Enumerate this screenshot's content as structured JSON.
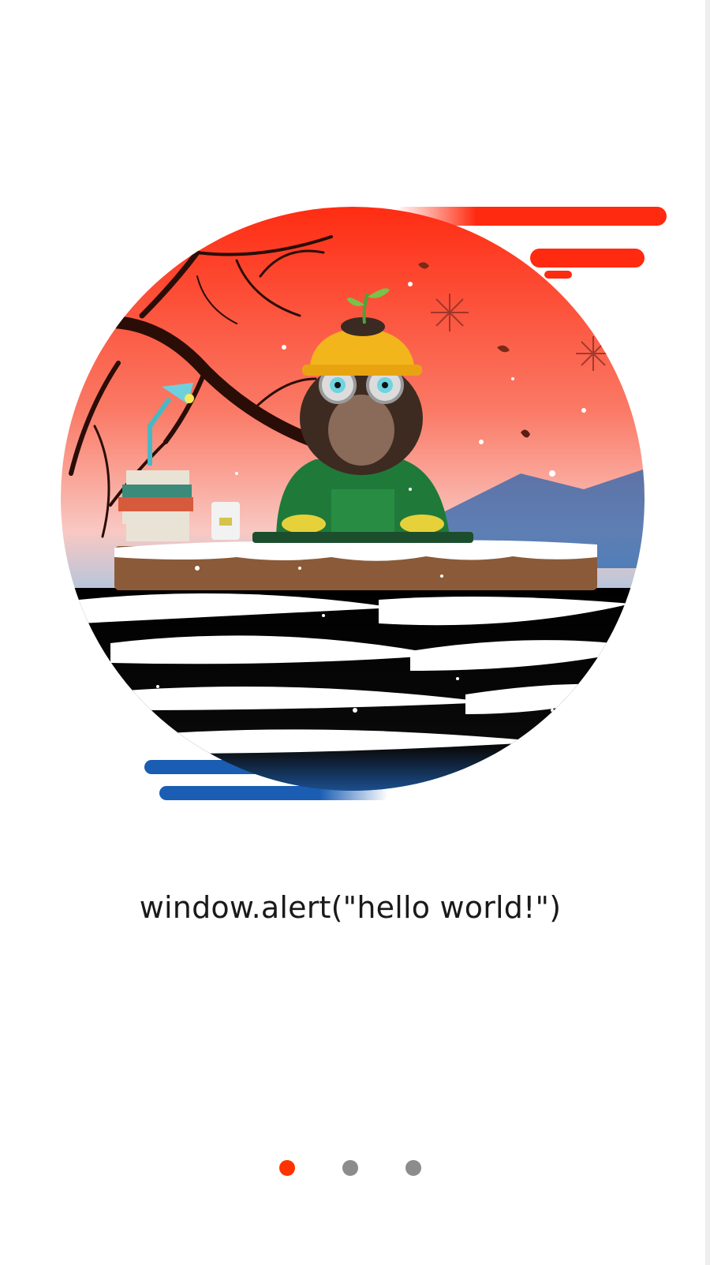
{
  "onboarding": {
    "caption": "window.alert(\"hello world!\")",
    "pager": {
      "current": 1,
      "total": 3
    },
    "colors": {
      "accent": "#ff3300",
      "dot_inactive": "#8c8c8c",
      "sky_top": "#ff3a1a",
      "sky_mid": "#f7a49a",
      "water_blue": "#1e6fc4",
      "helmet": "#f2b51b",
      "shirt": "#1f7a3a"
    },
    "illustration": {
      "icon": "monkey-developer-illustration"
    }
  }
}
